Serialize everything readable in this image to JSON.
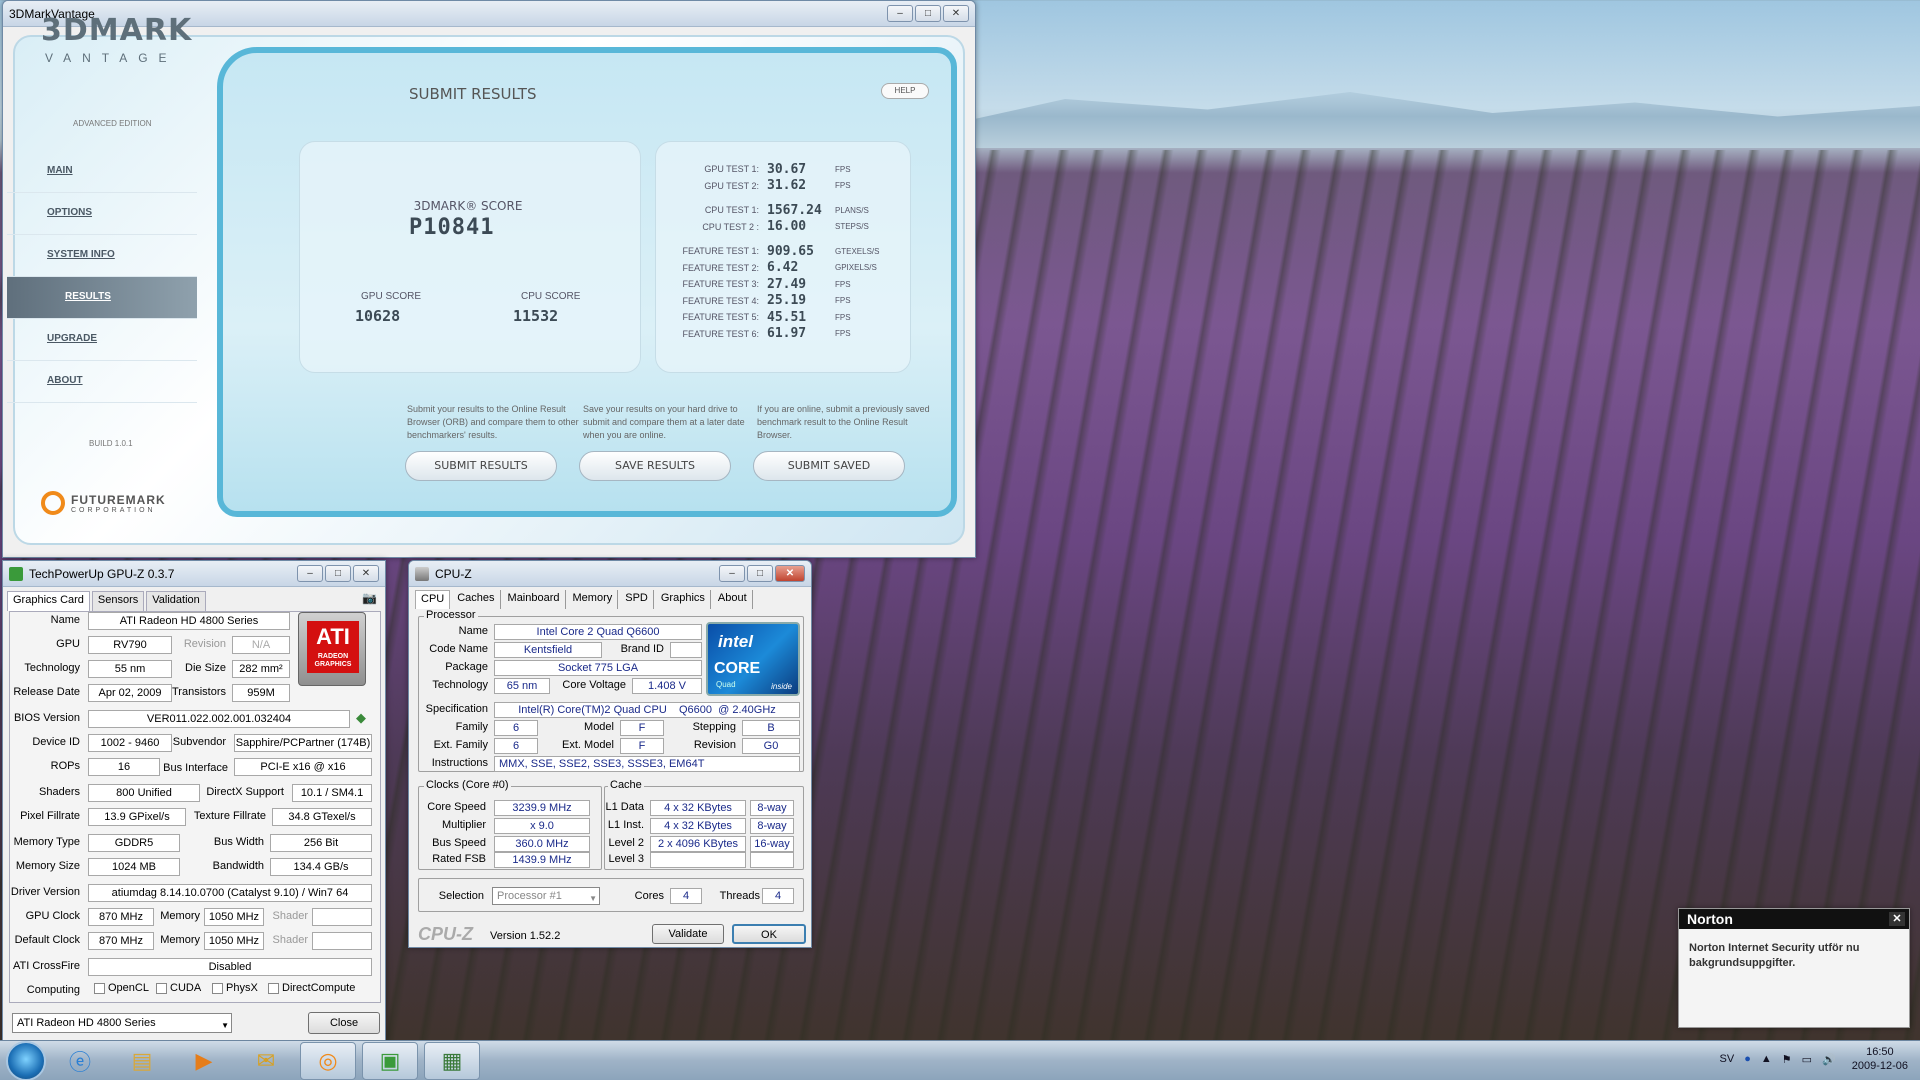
{
  "vantage": {
    "title": "3DMarkVantage",
    "logo": "3DMARK",
    "logo_sub": "VANTAGE",
    "edition": "ADVANCED EDITION",
    "nav": [
      "MAIN",
      "OPTIONS",
      "SYSTEM INFO",
      "RESULTS",
      "UPGRADE",
      "ABOUT"
    ],
    "build": "BUILD 1.0.1",
    "futuremark": "FUTUREMARK",
    "corporation": "CORPORATION",
    "page_title": "SUBMIT RESULTS",
    "help": "HELP",
    "score_label": "3DMARK® SCORE",
    "score": "P10841",
    "gpu_score_label": "GPU SCORE",
    "gpu_score": "10628",
    "cpu_score_label": "CPU SCORE",
    "cpu_score": "11532",
    "tests": [
      {
        "label": "GPU TEST 1:",
        "value": "30.67",
        "unit": "FPS"
      },
      {
        "label": "GPU TEST 2:",
        "value": "31.62",
        "unit": "FPS"
      },
      {
        "label": "CPU TEST 1:",
        "value": "1567.24",
        "unit": "PLANS/S"
      },
      {
        "label": "CPU TEST 2 :",
        "value": "16.00",
        "unit": "STEPS/S"
      },
      {
        "label": "FEATURE TEST 1:",
        "value": "909.65",
        "unit": "GTEXELS/S"
      },
      {
        "label": "FEATURE TEST 2:",
        "value": "6.42",
        "unit": "GPIXELS/S"
      },
      {
        "label": "FEATURE TEST 3:",
        "value": "27.49",
        "unit": "FPS"
      },
      {
        "label": "FEATURE TEST 4:",
        "value": "25.19",
        "unit": "FPS"
      },
      {
        "label": "FEATURE TEST 5:",
        "value": "45.51",
        "unit": "FPS"
      },
      {
        "label": "FEATURE TEST 6:",
        "value": "61.97",
        "unit": "FPS"
      }
    ],
    "desc_submit": "Submit your results to the Online Result Browser (ORB) and compare them to other benchmarkers' results.",
    "desc_save": "Save your results on your hard drive to submit and compare them at a later date when you are online.",
    "desc_saved": "If you are online, submit a previously saved benchmark result to the Online Result Browser.",
    "btn_submit": "SUBMIT RESULTS",
    "btn_save": "SAVE RESULTS",
    "btn_saved": "SUBMIT SAVED"
  },
  "gpuz": {
    "title": "TechPowerUp GPU-Z 0.3.7",
    "tabs": [
      "Graphics Card",
      "Sensors",
      "Validation"
    ],
    "name_l": "Name",
    "name": "ATI Radeon HD 4800 Series",
    "gpu_l": "GPU",
    "gpu": "RV790",
    "revision_l": "Revision",
    "revision": "N/A",
    "tech_l": "Technology",
    "tech": "55 nm",
    "die_l": "Die Size",
    "die": "282 mm²",
    "release_l": "Release Date",
    "release": "Apr 02, 2009",
    "trans_l": "Transistors",
    "trans": "959M",
    "bios_l": "BIOS Version",
    "bios": "VER011.022.002.001.032404",
    "devid_l": "Device ID",
    "devid": "1002 - 9460",
    "subv_l": "Subvendor",
    "subv": "Sapphire/PCPartner (174B)",
    "rops_l": "ROPs",
    "rops": "16",
    "bus_l": "Bus Interface",
    "bus": "PCI-E x16 @ x16",
    "shaders_l": "Shaders",
    "shaders": "800 Unified",
    "dx_l": "DirectX Support",
    "dx": "10.1 / SM4.1",
    "pix_l": "Pixel Fillrate",
    "pix": "13.9 GPixel/s",
    "tex_l": "Texture Fillrate",
    "tex": "34.8 GTexel/s",
    "memtype_l": "Memory Type",
    "memtype": "GDDR5",
    "bw_l": "Bus Width",
    "bw": "256 Bit",
    "memsize_l": "Memory Size",
    "memsize": "1024 MB",
    "band_l": "Bandwidth",
    "band": "134.4 GB/s",
    "driver_l": "Driver Version",
    "driver": "atiumdag 8.14.10.0700 (Catalyst 9.10) / Win7 64",
    "gclk_l": "GPU Clock",
    "gclk": "870 MHz",
    "mem_l": "Memory",
    "mclk": "1050 MHz",
    "shader_l": "Shader",
    "dclk_l": "Default Clock",
    "dclk": "870 MHz",
    "dmclk": "1050 MHz",
    "cf_l": "ATI CrossFire",
    "cf": "Disabled",
    "comp_l": "Computing",
    "opencl": "OpenCL",
    "cuda": "CUDA",
    "physx": "PhysX",
    "dc": "DirectCompute",
    "ati_logo": "ATI",
    "ati_sub": "RADEON",
    "ati_sub2": "GRAPHICS",
    "select": "ATI Radeon HD 4800 Series",
    "close": "Close"
  },
  "cpuz": {
    "title": "CPU-Z",
    "tabs": [
      "CPU",
      "Caches",
      "Mainboard",
      "Memory",
      "SPD",
      "Graphics",
      "About"
    ],
    "processor": "Processor",
    "name_l": "Name",
    "name": "Intel Core 2 Quad Q6600",
    "code_l": "Code Name",
    "code": "Kentsfield",
    "brand_l": "Brand ID",
    "pkg_l": "Package",
    "pkg": "Socket 775 LGA",
    "tech_l": "Technology",
    "tech": "65 nm",
    "volt_l": "Core Voltage",
    "volt": "1.408 V",
    "spec_l": "Specification",
    "spec": "Intel(R) Core(TM)2 Quad CPU    Q6600  @ 2.40GHz",
    "fam_l": "Family",
    "fam": "6",
    "model_l": "Model",
    "model": "F",
    "step_l": "Stepping",
    "step": "B",
    "efam_l": "Ext. Family",
    "efam": "6",
    "emodel_l": "Ext. Model",
    "emodel": "F",
    "rev_l": "Revision",
    "rev": "G0",
    "instr_l": "Instructions",
    "instr": "MMX, SSE, SSE2, SSE3, SSSE3, EM64T",
    "clocks": "Clocks (Core #0)",
    "cache": "Cache",
    "cs_l": "Core Speed",
    "cs": "3239.9 MHz",
    "mult_l": "Multiplier",
    "mult": "x 9.0",
    "bs_l": "Bus Speed",
    "bs": "360.0 MHz",
    "fsb_l": "Rated FSB",
    "fsb": "1439.9 MHz",
    "l1d_l": "L1 Data",
    "l1d": "4 x 32 KBytes",
    "l1d_w": "8-way",
    "l1i_l": "L1 Inst.",
    "l1i": "4 x 32 KBytes",
    "l1i_w": "8-way",
    "l2_l": "Level 2",
    "l2": "2 x 4096 KBytes",
    "l2_w": "16-way",
    "l3_l": "Level 3",
    "sel_l": "Selection",
    "sel": "Processor #1",
    "cores_l": "Cores",
    "cores": "4",
    "threads_l": "Threads",
    "threads": "4",
    "logo": "CPU-Z",
    "version": "Version 1.52.2",
    "validate": "Validate",
    "ok": "OK",
    "intel": "intel",
    "core": "CORE",
    "quad": "Quad",
    "inside": "inside"
  },
  "norton": {
    "title": "Norton",
    "message": "Norton Internet Security utför nu bakgrundsuppgifter."
  },
  "taskbar": {
    "lang": "SV",
    "time": "16:50",
    "date": "2009-12-06"
  }
}
